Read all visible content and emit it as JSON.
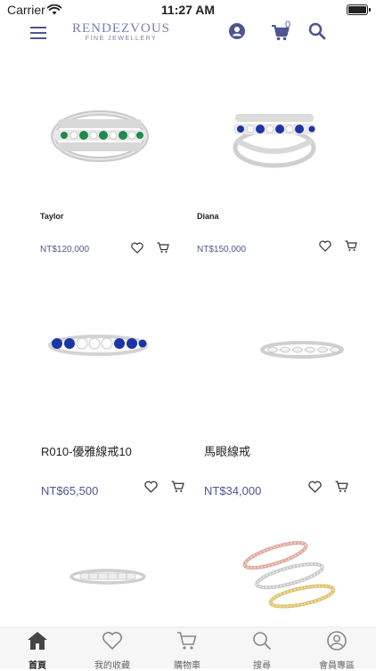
{
  "status": {
    "carrier": "Carrier",
    "time": "11:27 AM"
  },
  "brand": {
    "name": "RENDEZVOUS",
    "tagline": "FINE JEWELLERY"
  },
  "header": {
    "cart_count": "0"
  },
  "products": [
    {
      "name": "Taylor",
      "price": "NT$120,000",
      "image": "emerald-ring-image"
    },
    {
      "name": "Diana",
      "price": "NT$150,000",
      "image": "sapphire-ring-image"
    },
    {
      "name": "R010-優雅線戒10",
      "price": "NT$65,500",
      "image": "sapphire-band-image"
    },
    {
      "name": "馬眼線戒",
      "price": "NT$34,000",
      "image": "marquise-band-image"
    },
    {
      "name": "",
      "price": "",
      "image": "diamond-band-image"
    },
    {
      "name": "",
      "price": "",
      "image": "stacked-bands-image"
    }
  ],
  "tabs": [
    {
      "label": "首頁",
      "icon": "home-icon"
    },
    {
      "label": "我的收藏",
      "icon": "heart-icon"
    },
    {
      "label": "購物車",
      "icon": "cart-icon"
    },
    {
      "label": "搜尋",
      "icon": "search-icon"
    },
    {
      "label": "會員專區",
      "icon": "user-icon"
    }
  ],
  "colors": {
    "accent": "#4d5690",
    "brand": "#7a7fa8"
  }
}
